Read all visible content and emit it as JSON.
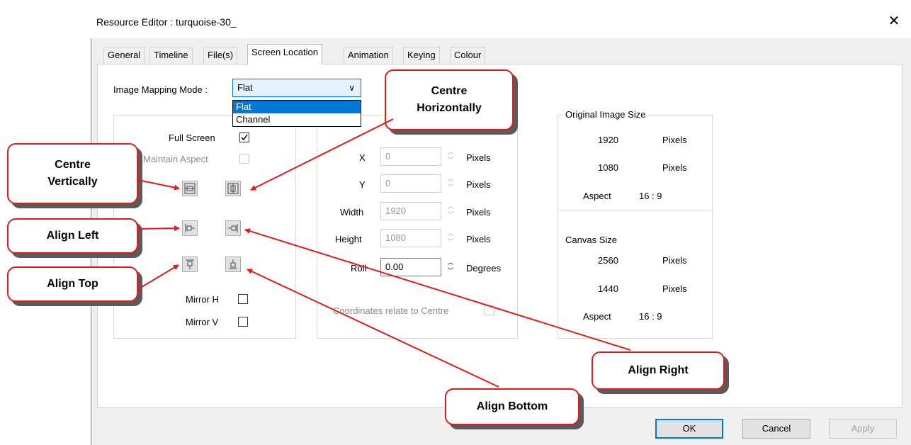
{
  "window": {
    "title": "Resource Editor  :  turquoise-30_",
    "close_glyph": "✕"
  },
  "tabs": [
    {
      "label": "General"
    },
    {
      "label": "Timeline"
    },
    {
      "label": "File(s)"
    },
    {
      "label": "Screen Location",
      "active": true
    },
    {
      "label": "Animation"
    },
    {
      "label": "Keying"
    },
    {
      "label": "Colour"
    }
  ],
  "mapping": {
    "label": "Image Mapping Mode :",
    "selected": "Flat",
    "options": [
      "Flat",
      "Channel"
    ]
  },
  "left_group": {
    "full_screen_label": "Full Screen",
    "full_screen_checked": true,
    "maintain_aspect_label": "Maintain Aspect",
    "maintain_aspect_checked": false,
    "mirror_h_label": "Mirror H",
    "mirror_v_label": "Mirror V",
    "mirror_h_checked": false,
    "mirror_v_checked": false,
    "buttons": [
      "centre-vertically",
      "centre-horizontally",
      "align-left",
      "align-right",
      "align-top",
      "align-bottom"
    ]
  },
  "position": {
    "x_label": "X",
    "x_value": "0",
    "x_unit": "Pixels",
    "y_label": "Y",
    "y_value": "0",
    "y_unit": "Pixels",
    "width_label": "Width",
    "width_value": "1920",
    "width_unit": "Pixels",
    "height_label": "Height",
    "height_value": "1080",
    "height_unit": "Pixels",
    "roll_label": "Roll",
    "roll_value": "0.00",
    "roll_unit": "Degrees",
    "centre_label": "Coordinates relate to Centre"
  },
  "original_size": {
    "title": "Original Image Size",
    "width": "1920",
    "width_unit": "Pixels",
    "height": "1080",
    "height_unit": "Pixels",
    "aspect_label": "Aspect",
    "aspect_value": "16 : 9"
  },
  "canvas_size": {
    "title": "Canvas Size",
    "width": "2560",
    "width_unit": "Pixels",
    "height": "1440",
    "height_unit": "Pixels",
    "aspect_label": "Aspect",
    "aspect_value": "16 : 9"
  },
  "footer": {
    "ok": "OK",
    "cancel": "Cancel",
    "apply": "Apply"
  },
  "callouts": {
    "centre_horizontally": [
      "Centre",
      "Horizontally"
    ],
    "centre_vertically": [
      "Centre",
      "Vertically"
    ],
    "align_left": "Align Left",
    "align_top": "Align Top",
    "align_right": "Align Right",
    "align_bottom": "Align Bottom"
  },
  "colors": {
    "callout_border": "#e21a1a",
    "accent": "#0078d7",
    "dialog_bg": "#f0f0f0"
  }
}
